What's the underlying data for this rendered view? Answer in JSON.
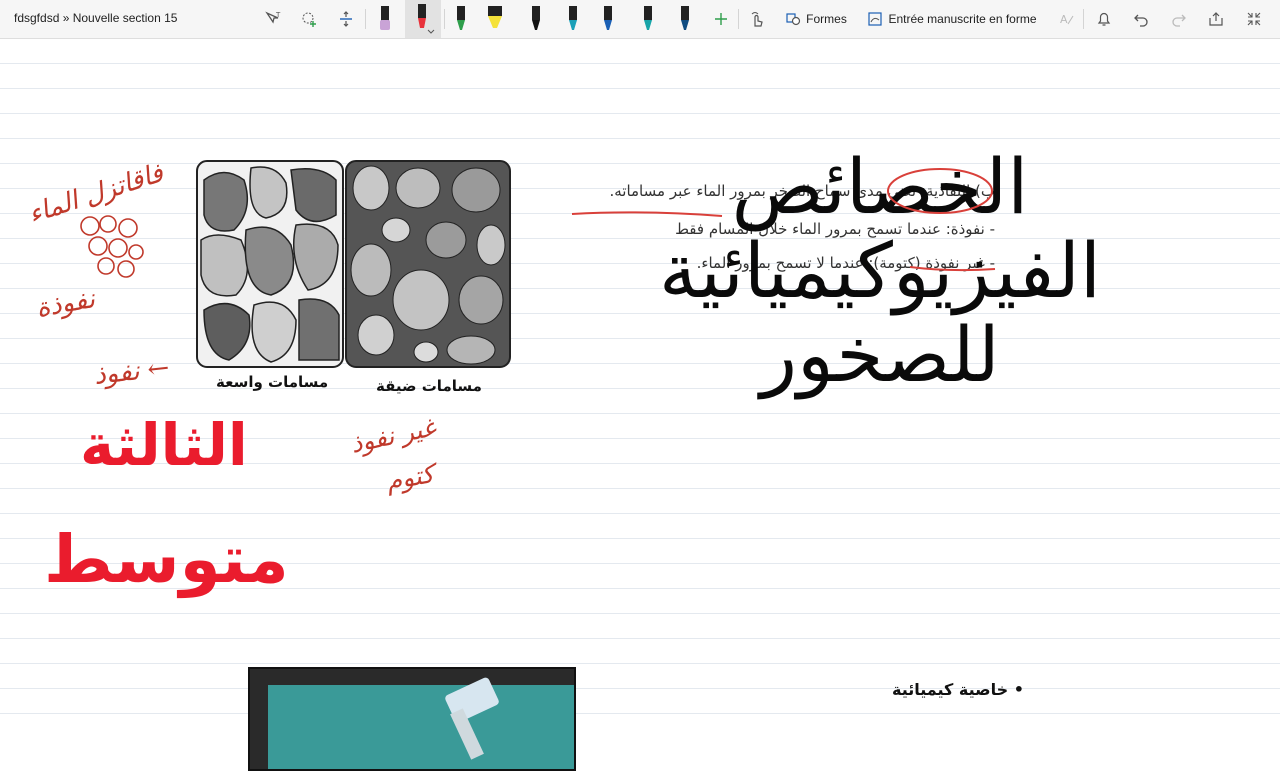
{
  "toolbar": {
    "breadcrumb": "fdsgfdsd » Nouvelle section 15",
    "shapes_label": "Formes",
    "ink_to_shape_label": "Entrée manuscrite en forme",
    "pens": [
      {
        "name": "pen-purple",
        "color": "#c9a3d6"
      },
      {
        "name": "pen-red",
        "color": "#e8323b"
      },
      {
        "name": "pen-green",
        "color": "#2e9e4b"
      },
      {
        "name": "pen-yellow",
        "color": "#f5e23a"
      },
      {
        "name": "pen-black",
        "color": "#111111"
      },
      {
        "name": "pen-teal",
        "color": "#1aa0b8"
      },
      {
        "name": "pen-blue",
        "color": "#1a5fb4"
      },
      {
        "name": "pen-teal-2",
        "color": "#17a4a8"
      },
      {
        "name": "pen-navy",
        "color": "#0f4c81"
      }
    ]
  },
  "doc": {
    "para1": "ب) النفاذية: تعني مدى سماح الصخر بمرور الماء عبر مساماته.",
    "para2": "- نفوذة: عندما تسمح بمرور الماء خلال المسام فقط",
    "para3": "- غير نفوذة (كتومة): عندما لا تسمح بمرور الماء."
  },
  "figure": {
    "caption_wide": "مسامات واسعة",
    "caption_narrow": "مسامات ضيقة"
  },
  "title": {
    "line1": "الخصائص",
    "line2": "الفيزيوكيميائية",
    "line3": "للصخور"
  },
  "level": {
    "line1": "الثالثة",
    "line2": "متوسط"
  },
  "handwriting": {
    "note1": "فاقاتزل الماء",
    "note2": "نفوذة",
    "note3": "← نفوذ",
    "note4": "غير نفوذ",
    "note5": "كتوم"
  },
  "bottom": {
    "bullet": "• خاصية كيميائية"
  },
  "colors": {
    "title": "#0a0a0a",
    "level_red": "#ea1c2d",
    "handwriting": "#c0392b"
  }
}
